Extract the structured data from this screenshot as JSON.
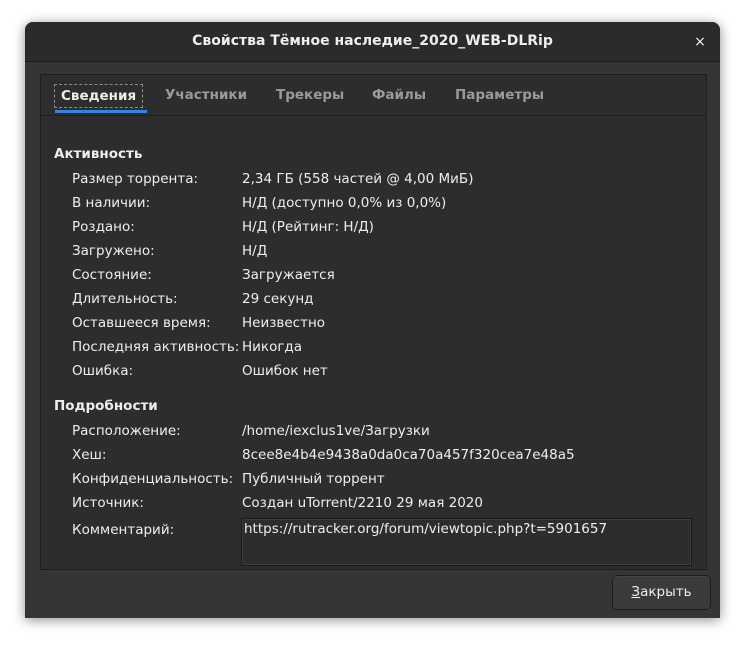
{
  "window": {
    "title": "Свойства Тёмное наследие_2020_WEB-DLRip",
    "close_icon": "×"
  },
  "tabs": [
    {
      "label": "Сведения",
      "active": true
    },
    {
      "label": "Участники",
      "active": false
    },
    {
      "label": "Трекеры",
      "active": false
    },
    {
      "label": "Файлы",
      "active": false
    },
    {
      "label": "Параметры",
      "active": false
    }
  ],
  "activity": {
    "heading": "Активность",
    "rows": [
      {
        "label": "Размер торрента:",
        "value": "2,34 ГБ (558 частей @ 4,00 МиБ)"
      },
      {
        "label": "В наличии:",
        "value": "Н/Д (доступно 0,0% из 0,0%)"
      },
      {
        "label": "Роздано:",
        "value": "Н/Д (Рейтинг: Н/Д)"
      },
      {
        "label": "Загружено:",
        "value": "Н/Д"
      },
      {
        "label": "Состояние:",
        "value": "Загружается"
      },
      {
        "label": "Длительность:",
        "value": "29 секунд"
      },
      {
        "label": "Оставшееся время:",
        "value": "Неизвестно"
      },
      {
        "label": "Последняя активность:",
        "value": "Никогда"
      },
      {
        "label": "Ошибка:",
        "value": "Ошибок нет"
      }
    ]
  },
  "details": {
    "heading": "Подробности",
    "rows": [
      {
        "label": "Расположение:",
        "value": "/home/iexclus1ve/Загрузки"
      },
      {
        "label": "Хеш:",
        "value": "8cee8e4b4e9438a0da0ca70a457f320cea7e48a5"
      },
      {
        "label": "Конфиденциальность:",
        "value": "Публичный торрент"
      },
      {
        "label": "Источник:",
        "value": "Создан uTorrent/2210 29 мая 2020"
      }
    ],
    "comment_label": "Комментарий:",
    "comment_value": "https://rutracker.org/forum/viewtopic.php?t=5901657"
  },
  "buttons": {
    "close_mnemonic": "З",
    "close_rest": "акрыть"
  },
  "colors": {
    "accent": "#3584e4",
    "window_bg": "#353535",
    "text": "#eeeeec"
  }
}
